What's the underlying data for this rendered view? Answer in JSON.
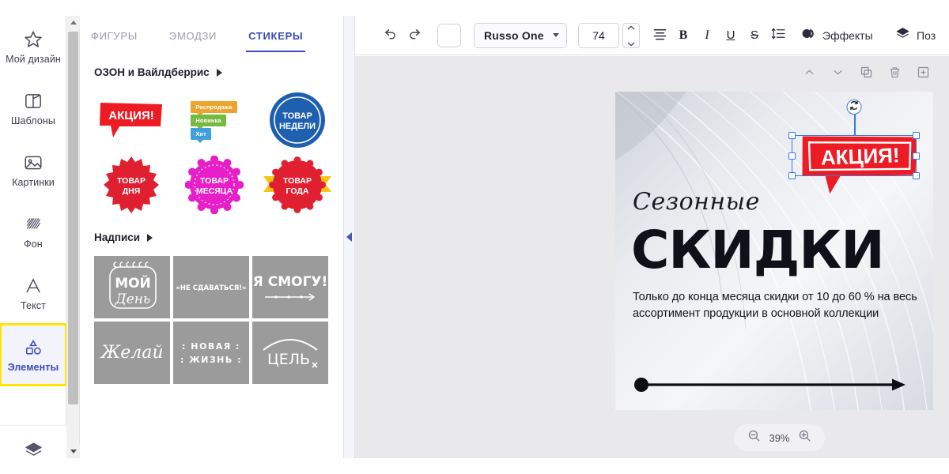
{
  "sidebar": {
    "items": [
      {
        "label": "Мой дизайн",
        "icon": "star-icon",
        "active": false
      },
      {
        "label": "Шаблоны",
        "icon": "templates-icon",
        "active": false
      },
      {
        "label": "Картинки",
        "icon": "image-icon",
        "active": false
      },
      {
        "label": "Фон",
        "icon": "pattern-icon",
        "active": false
      },
      {
        "label": "Текст",
        "icon": "text-a-icon",
        "active": false
      },
      {
        "label": "Элементы",
        "icon": "elements-icon",
        "active": true
      }
    ],
    "bottom_icon": "layers-icon"
  },
  "panel": {
    "tabs": [
      {
        "label": "ФИГУРЫ",
        "active": false
      },
      {
        "label": "ЭМОДЗИ",
        "active": false
      },
      {
        "label": "СТИКЕРЫ",
        "active": true
      }
    ],
    "sections": [
      {
        "title": "ОЗОН и Вайлдберрис",
        "chevron": "chevron-right-icon",
        "rows": [
          [
            {
              "kind": "speech-bubble",
              "text": "АКЦИЯ!",
              "color": "#ed1c24"
            },
            {
              "kind": "badge-stack",
              "badges": [
                {
                  "text": "Распродажа",
                  "color": "#eda32e"
                },
                {
                  "text": "Новинка",
                  "color": "#76bb3f"
                },
                {
                  "text": "Хит",
                  "color": "#3fa0dd"
                }
              ]
            },
            {
              "kind": "circle-badge",
              "line1": "ТОВАР",
              "line2": "НЕДЕЛИ",
              "color": "#1f5fb0"
            }
          ],
          [
            {
              "kind": "starburst-badge",
              "line1": "ТОВАР",
              "line2": "ДНЯ",
              "color": "#e02030"
            },
            {
              "kind": "scallop-badge",
              "line1": "ТОВАР",
              "line2": "МЕСЯЦА",
              "color": "#e81ec8"
            },
            {
              "kind": "ribbon-badge",
              "line1": "ТОВАР",
              "line2": "ГОДА",
              "color": "#e02030",
              "ribbon_color": "#f5c518"
            }
          ]
        ]
      },
      {
        "title": "Надписи",
        "chevron": "chevron-right-icon",
        "rows": [
          [
            {
              "kind": "lettering",
              "line1": "МОЙ",
              "line2": "День"
            },
            {
              "kind": "lettering",
              "line1": "»НЕ СДАВАТЬСЯ!«",
              "line2": ""
            },
            {
              "kind": "lettering",
              "line1": "Я СМОГУ!",
              "line2": ""
            }
          ],
          [
            {
              "kind": "lettering",
              "line1": "Желай",
              "line2": ""
            },
            {
              "kind": "lettering",
              "line1": ": НОВАЯ :",
              "line2": ": ЖИЗНЬ :"
            },
            {
              "kind": "lettering",
              "line1": "ЦЕЛЬ",
              "line2": ""
            }
          ]
        ]
      }
    ],
    "collapse_icon": "collapse-left-icon"
  },
  "toolbar": {
    "undo_icon": "undo-icon",
    "redo_icon": "redo-icon",
    "color_swatch": "#ffffff",
    "font_name": "Russo One",
    "font_size": "74",
    "align_icon": "align-center-icon",
    "bold_label": "B",
    "italic_label": "I",
    "underline_label": "U",
    "strike_label": "S",
    "line_spacing_icon": "line-spacing-icon",
    "effects_label": "Эффекты",
    "effects_icon": "effects-icon",
    "position_label": "Поз",
    "position_icon": "layers-icon"
  },
  "canvas": {
    "tools": [
      {
        "icon": "chevron-up-icon",
        "name": "move-up-button"
      },
      {
        "icon": "chevron-down-icon",
        "name": "move-down-button"
      },
      {
        "icon": "duplicate-icon",
        "name": "duplicate-button"
      },
      {
        "icon": "trash-icon",
        "name": "delete-button"
      },
      {
        "icon": "plus-box-icon",
        "name": "add-button"
      }
    ],
    "design": {
      "script_title": "Сезонные",
      "big_title": "СКИДКИ",
      "body_text": "Только до конца месяца скидки от 10 до 60 % на весь ассортимент продукции в основной коллекции",
      "sticker_text": "АКЦИЯ!",
      "sticker_color": "#ed1c24"
    },
    "selection": {
      "handle_color": "#3a79e6",
      "rotate_icon": "rotate-icon"
    },
    "zoom": {
      "out_icon": "zoom-out-icon",
      "value": "39%",
      "in_icon": "zoom-in-icon"
    }
  }
}
